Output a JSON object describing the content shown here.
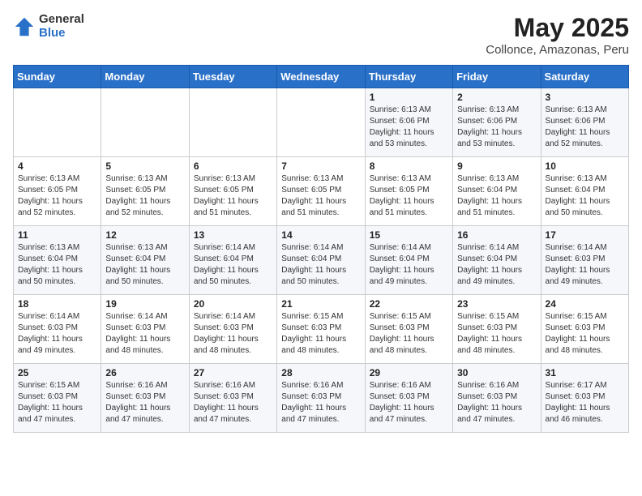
{
  "header": {
    "logo_general": "General",
    "logo_blue": "Blue",
    "title": "May 2025",
    "subtitle": "Collonce, Amazonas, Peru"
  },
  "weekdays": [
    "Sunday",
    "Monday",
    "Tuesday",
    "Wednesday",
    "Thursday",
    "Friday",
    "Saturday"
  ],
  "weeks": [
    [
      {
        "day": "",
        "info": ""
      },
      {
        "day": "",
        "info": ""
      },
      {
        "day": "",
        "info": ""
      },
      {
        "day": "",
        "info": ""
      },
      {
        "day": "1",
        "info": "Sunrise: 6:13 AM\nSunset: 6:06 PM\nDaylight: 11 hours\nand 53 minutes."
      },
      {
        "day": "2",
        "info": "Sunrise: 6:13 AM\nSunset: 6:06 PM\nDaylight: 11 hours\nand 53 minutes."
      },
      {
        "day": "3",
        "info": "Sunrise: 6:13 AM\nSunset: 6:06 PM\nDaylight: 11 hours\nand 52 minutes."
      }
    ],
    [
      {
        "day": "4",
        "info": "Sunrise: 6:13 AM\nSunset: 6:05 PM\nDaylight: 11 hours\nand 52 minutes."
      },
      {
        "day": "5",
        "info": "Sunrise: 6:13 AM\nSunset: 6:05 PM\nDaylight: 11 hours\nand 52 minutes."
      },
      {
        "day": "6",
        "info": "Sunrise: 6:13 AM\nSunset: 6:05 PM\nDaylight: 11 hours\nand 51 minutes."
      },
      {
        "day": "7",
        "info": "Sunrise: 6:13 AM\nSunset: 6:05 PM\nDaylight: 11 hours\nand 51 minutes."
      },
      {
        "day": "8",
        "info": "Sunrise: 6:13 AM\nSunset: 6:05 PM\nDaylight: 11 hours\nand 51 minutes."
      },
      {
        "day": "9",
        "info": "Sunrise: 6:13 AM\nSunset: 6:04 PM\nDaylight: 11 hours\nand 51 minutes."
      },
      {
        "day": "10",
        "info": "Sunrise: 6:13 AM\nSunset: 6:04 PM\nDaylight: 11 hours\nand 50 minutes."
      }
    ],
    [
      {
        "day": "11",
        "info": "Sunrise: 6:13 AM\nSunset: 6:04 PM\nDaylight: 11 hours\nand 50 minutes."
      },
      {
        "day": "12",
        "info": "Sunrise: 6:13 AM\nSunset: 6:04 PM\nDaylight: 11 hours\nand 50 minutes."
      },
      {
        "day": "13",
        "info": "Sunrise: 6:14 AM\nSunset: 6:04 PM\nDaylight: 11 hours\nand 50 minutes."
      },
      {
        "day": "14",
        "info": "Sunrise: 6:14 AM\nSunset: 6:04 PM\nDaylight: 11 hours\nand 50 minutes."
      },
      {
        "day": "15",
        "info": "Sunrise: 6:14 AM\nSunset: 6:04 PM\nDaylight: 11 hours\nand 49 minutes."
      },
      {
        "day": "16",
        "info": "Sunrise: 6:14 AM\nSunset: 6:04 PM\nDaylight: 11 hours\nand 49 minutes."
      },
      {
        "day": "17",
        "info": "Sunrise: 6:14 AM\nSunset: 6:03 PM\nDaylight: 11 hours\nand 49 minutes."
      }
    ],
    [
      {
        "day": "18",
        "info": "Sunrise: 6:14 AM\nSunset: 6:03 PM\nDaylight: 11 hours\nand 49 minutes."
      },
      {
        "day": "19",
        "info": "Sunrise: 6:14 AM\nSunset: 6:03 PM\nDaylight: 11 hours\nand 48 minutes."
      },
      {
        "day": "20",
        "info": "Sunrise: 6:14 AM\nSunset: 6:03 PM\nDaylight: 11 hours\nand 48 minutes."
      },
      {
        "day": "21",
        "info": "Sunrise: 6:15 AM\nSunset: 6:03 PM\nDaylight: 11 hours\nand 48 minutes."
      },
      {
        "day": "22",
        "info": "Sunrise: 6:15 AM\nSunset: 6:03 PM\nDaylight: 11 hours\nand 48 minutes."
      },
      {
        "day": "23",
        "info": "Sunrise: 6:15 AM\nSunset: 6:03 PM\nDaylight: 11 hours\nand 48 minutes."
      },
      {
        "day": "24",
        "info": "Sunrise: 6:15 AM\nSunset: 6:03 PM\nDaylight: 11 hours\nand 48 minutes."
      }
    ],
    [
      {
        "day": "25",
        "info": "Sunrise: 6:15 AM\nSunset: 6:03 PM\nDaylight: 11 hours\nand 47 minutes."
      },
      {
        "day": "26",
        "info": "Sunrise: 6:16 AM\nSunset: 6:03 PM\nDaylight: 11 hours\nand 47 minutes."
      },
      {
        "day": "27",
        "info": "Sunrise: 6:16 AM\nSunset: 6:03 PM\nDaylight: 11 hours\nand 47 minutes."
      },
      {
        "day": "28",
        "info": "Sunrise: 6:16 AM\nSunset: 6:03 PM\nDaylight: 11 hours\nand 47 minutes."
      },
      {
        "day": "29",
        "info": "Sunrise: 6:16 AM\nSunset: 6:03 PM\nDaylight: 11 hours\nand 47 minutes."
      },
      {
        "day": "30",
        "info": "Sunrise: 6:16 AM\nSunset: 6:03 PM\nDaylight: 11 hours\nand 47 minutes."
      },
      {
        "day": "31",
        "info": "Sunrise: 6:17 AM\nSunset: 6:03 PM\nDaylight: 11 hours\nand 46 minutes."
      }
    ]
  ]
}
